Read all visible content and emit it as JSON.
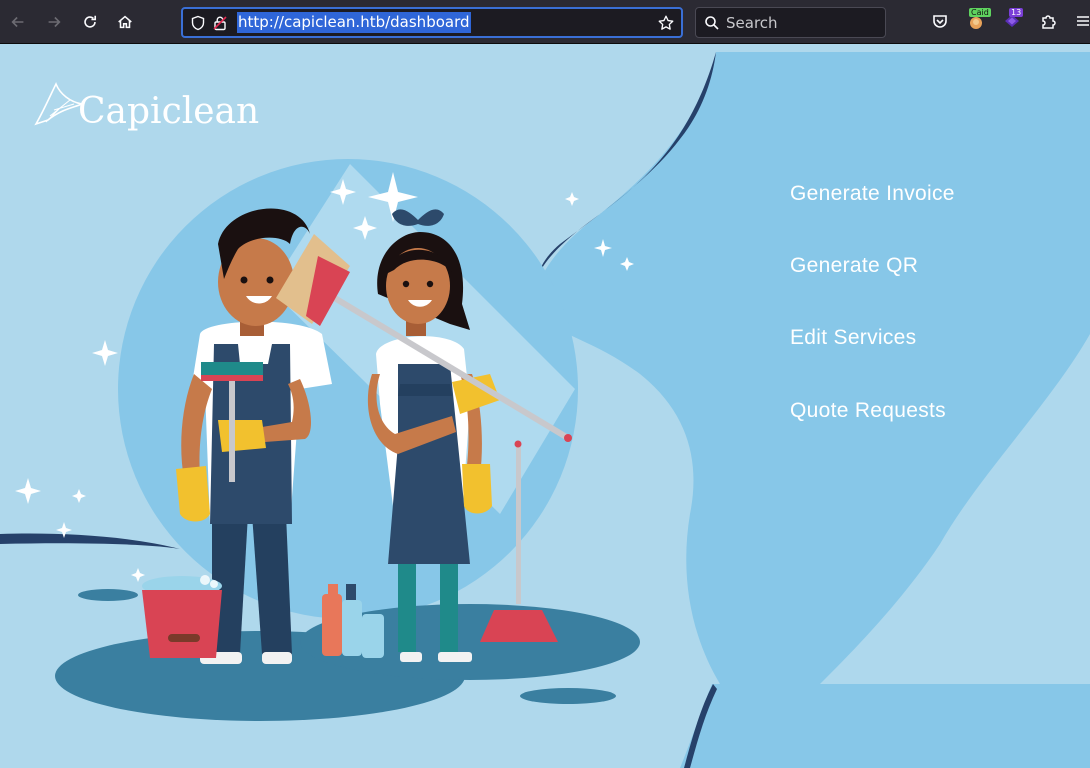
{
  "browser": {
    "url": "http://capiclean.htb/dashboard",
    "search_placeholder": "Search",
    "extensions": [
      {
        "name": "caido-extension-icon",
        "badge": "Caid"
      },
      {
        "name": "hackbar-extension-icon",
        "badge": "13"
      }
    ]
  },
  "site": {
    "logo_text": "Capiclean",
    "nav": [
      {
        "label": "Generate Invoice"
      },
      {
        "label": "Generate QR"
      },
      {
        "label": "Edit Services"
      },
      {
        "label": "Quote Requests"
      }
    ]
  },
  "colors": {
    "page_bg": "#afd8ec",
    "panel_blue": "#87c7e8",
    "dark_navy": "#2d4a6b",
    "toolbar_bg": "#2b2a33",
    "url_highlight": "#2f66d8"
  }
}
